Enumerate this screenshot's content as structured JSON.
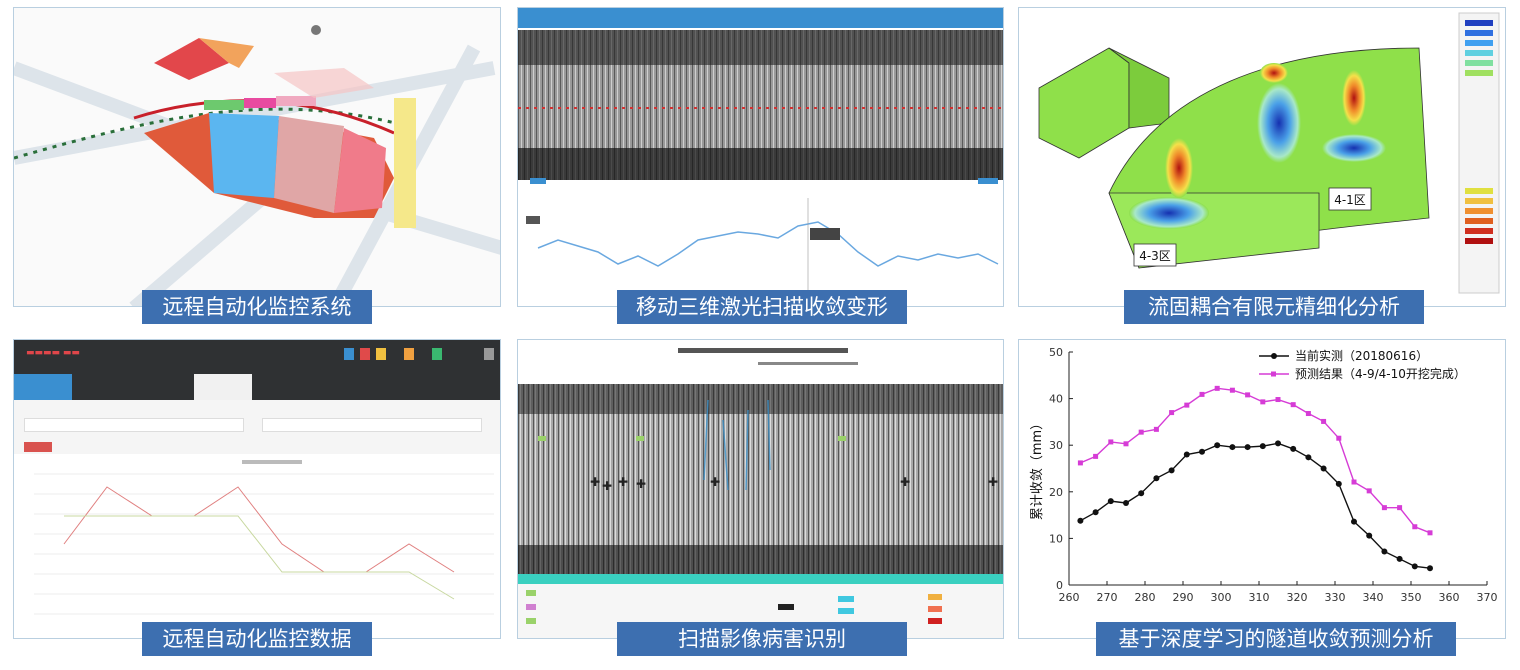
{
  "captions": {
    "remote_system": "远程自动化监控系统",
    "laser_scan": "移动三维激光扫描收敛变形",
    "fsi_fem": "流固耦合有限元精细化分析",
    "remote_data": "远程自动化监控数据",
    "scan_disease": "扫描影像病害识别",
    "dl_forecast": "基于深度学习的隧道收敛预测分析"
  },
  "fem_labels": {
    "zone_a": "4-1区",
    "zone_b": "4-3区"
  },
  "colors": {
    "caption_bg": "#3d6fb0",
    "panel_border": "#b9cfe0",
    "measured": "#111111",
    "predicted": "#d63cd6",
    "fem_green": "#8fe04a"
  },
  "chart_data": {
    "type": "line",
    "ylabel": "累计收敛（mm）",
    "xlim": [
      260,
      370
    ],
    "ylim": [
      0,
      50
    ],
    "xticks": [
      "260",
      "270",
      "280",
      "290",
      "300",
      "310",
      "320",
      "330",
      "340",
      "350",
      "360",
      "370"
    ],
    "yticks": [
      "0",
      "10",
      "20",
      "30",
      "40",
      "50"
    ],
    "legend_position": "top-center",
    "series": [
      {
        "name": "当前实测（20180616）",
        "color": "#111111",
        "marker": "circle",
        "x": [
          263,
          267,
          271,
          275,
          279,
          283,
          287,
          291,
          295,
          299,
          303,
          307,
          311,
          315,
          319,
          323,
          327,
          331,
          335,
          339,
          343,
          347,
          351,
          355
        ],
        "values": [
          13.8,
          15.6,
          18.0,
          17.6,
          19.7,
          22.9,
          24.6,
          28.0,
          28.6,
          30.0,
          29.6,
          29.6,
          29.8,
          30.4,
          29.2,
          27.4,
          25.0,
          21.7,
          13.6,
          10.6,
          7.2,
          5.6,
          4.0,
          3.6
        ]
      },
      {
        "name": "预测结果（4-9/4-10开挖完成）",
        "color": "#d63cd6",
        "marker": "square",
        "x": [
          263,
          267,
          271,
          275,
          279,
          283,
          287,
          291,
          295,
          299,
          303,
          307,
          311,
          315,
          319,
          323,
          327,
          331,
          335,
          339,
          343,
          347,
          351,
          355
        ],
        "values": [
          26.2,
          27.6,
          30.7,
          30.3,
          32.8,
          33.4,
          37.0,
          38.6,
          40.9,
          42.2,
          41.8,
          40.8,
          39.3,
          39.8,
          38.7,
          36.8,
          35.1,
          31.5,
          22.1,
          20.2,
          16.6,
          16.6,
          12.5,
          11.2
        ]
      }
    ]
  }
}
